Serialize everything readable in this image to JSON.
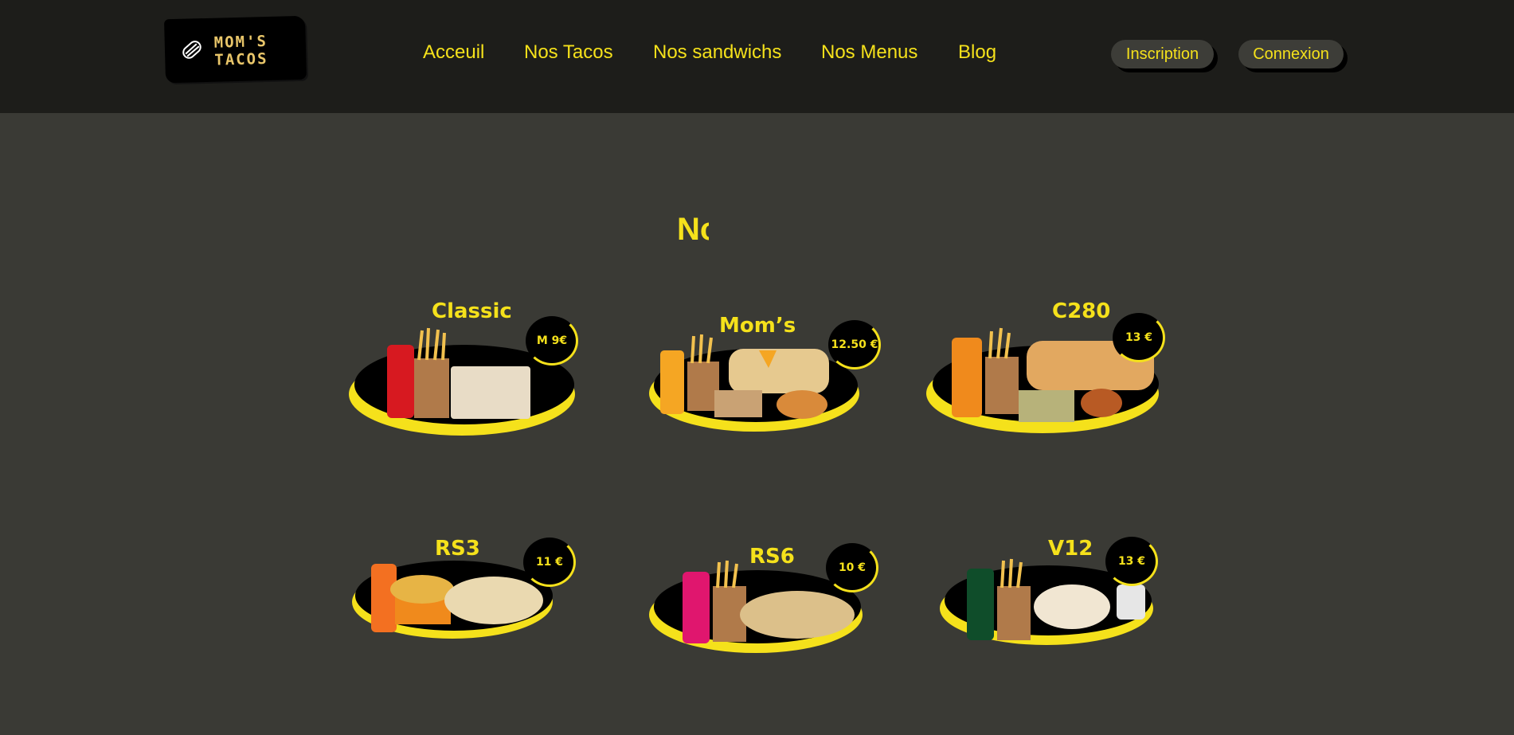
{
  "brand": {
    "logo_line1": "MOM'S",
    "logo_line2": "TACOS"
  },
  "nav": {
    "items": [
      {
        "label": "Acceuil"
      },
      {
        "label": "Nos Tacos"
      },
      {
        "label": "Nos sandwichs"
      },
      {
        "label": "Nos Menus"
      },
      {
        "label": "Blog"
      }
    ]
  },
  "auth": {
    "signup_label": "Inscription",
    "login_label": "Connexion"
  },
  "section": {
    "title": "Nos Menus"
  },
  "menus": [
    {
      "name": "Classic",
      "price": "M 9€"
    },
    {
      "name": "Mom’s",
      "price": "12.50 €"
    },
    {
      "name": "C280",
      "price": "13 €"
    },
    {
      "name": "RS3",
      "price": "11 €"
    },
    {
      "name": "RS6",
      "price": "10 €"
    },
    {
      "name": "V12",
      "price": "13 €"
    }
  ],
  "colors": {
    "accent": "#f5e11b",
    "header_bg": "#1d1d1a",
    "page_bg": "#3a3a35"
  }
}
